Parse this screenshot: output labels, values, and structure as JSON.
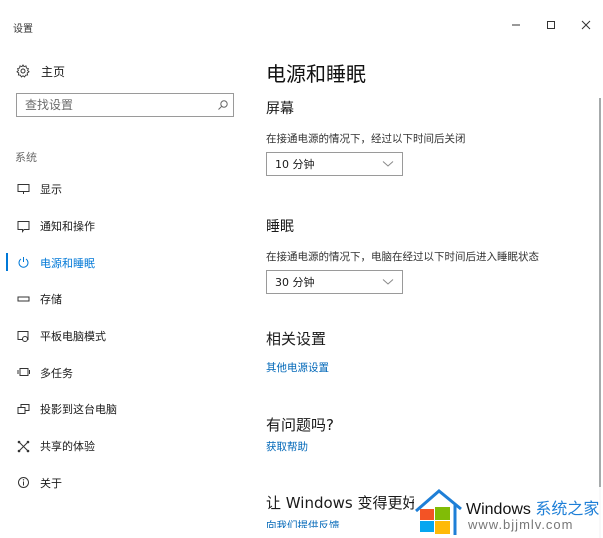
{
  "window": {
    "title": "设置",
    "controls": {
      "minimize": "minimize-icon",
      "maximize": "maximize-icon",
      "close": "close-icon"
    }
  },
  "sidebar": {
    "home": {
      "label": "主页",
      "icon": "gear-icon"
    },
    "search": {
      "placeholder": "查找设置",
      "value": "",
      "icon": "search-icon"
    },
    "group_label": "系统",
    "items": [
      {
        "label": "显示",
        "icon": "monitor-icon",
        "active": false
      },
      {
        "label": "通知和操作",
        "icon": "notification-icon",
        "active": false
      },
      {
        "label": "电源和睡眠",
        "icon": "power-icon",
        "active": true
      },
      {
        "label": "存储",
        "icon": "storage-icon",
        "active": false
      },
      {
        "label": "平板电脑模式",
        "icon": "tablet-mode-icon",
        "active": false
      },
      {
        "label": "多任务",
        "icon": "multitasking-icon",
        "active": false
      },
      {
        "label": "投影到这台电脑",
        "icon": "project-icon",
        "active": false
      },
      {
        "label": "共享的体验",
        "icon": "shared-experience-icon",
        "active": false
      },
      {
        "label": "关于",
        "icon": "info-icon",
        "active": false
      }
    ]
  },
  "main": {
    "title": "电源和睡眠",
    "screen": {
      "heading": "屏幕",
      "description": "在接通电源的情况下，经过以下时间后关闭",
      "selected": "10 分钟"
    },
    "sleep": {
      "heading": "睡眠",
      "description": "在接通电源的情况下，电脑在经过以下时间后进入睡眠状态",
      "selected": "30 分钟"
    },
    "related": {
      "heading": "相关设置",
      "link": "其他电源设置"
    },
    "help": {
      "heading": "有问题吗?",
      "link": "获取帮助"
    },
    "feedback": {
      "heading": "让 Windows 变得更好",
      "link": "向我们提供反馈"
    }
  },
  "watermark": {
    "brand_en": "Windows",
    "brand_cn": "系统之家",
    "url": "www.bjjmlv.com",
    "colors": {
      "red": "#f35325",
      "green": "#81bc06",
      "blue": "#05a6f0",
      "yellow": "#ffba08",
      "house": "#1e7fd7"
    }
  },
  "theme": {
    "accent": "#0078d7",
    "link": "#0067b8"
  }
}
